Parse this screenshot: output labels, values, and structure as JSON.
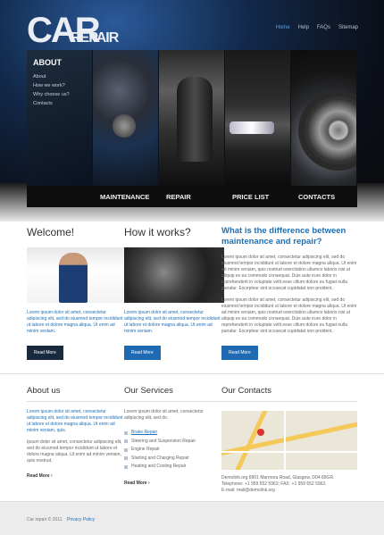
{
  "header": {
    "logo_big": "CAR",
    "logo_small": "REPAIR",
    "nav": [
      "Home",
      "Help",
      "FAQs",
      "Sitemap"
    ]
  },
  "about_panel": {
    "title": "ABOUT",
    "items": [
      "About",
      "How we work?",
      "Why choose us?",
      "Contacts"
    ]
  },
  "menu": [
    "Maintenance",
    "Repair",
    "Price list",
    "Contacts"
  ],
  "welcome": {
    "title": "Welcome!",
    "text": "Lorem ipsum dolor sit amet, consectetur adipiscing elit, sed do eiusmod tempor incididunt ut labore et dolore magna aliqua. Ut enim ad minim veniam.",
    "button": "Read More"
  },
  "how": {
    "title": "How it works?",
    "text": "Lorem ipsum dolor sit amet, consectetur adipiscing elit, sed do eiusmod tempor incididunt ut labore et dolore magna aliqua. Ut enim ad minim veniam.",
    "button": "Read More"
  },
  "difference": {
    "title": "What is the difference between maintenance and repair?",
    "p1": "Lorem ipsum dolor sit amet, consectetur adipiscing elit, sed do eiusmod tempor incididunt ut labore et dolore magna aliqua. Ut enim ad minim veniam, quis nostrud exercitation ullamco laboris nisi ut aliquip ex ea commodo consequat. Duis aute irure dolor in reprehenderit in voluptate velit esse cillum dolore eu fugiat nulla pariatur. Excepteur sint occaecat cupidatat non proident.",
    "p2": "Lorem ipsum dolor sit amet, consectetur adipiscing elit, sed do eiusmod tempor incididunt ut labore et dolore magna aliqua. Ut enim ad minim veniam, quis nostrud exercitation ullamco laboris nisi ut aliquip ex ea commodo consequat. Duis aute irure dolor in reprehenderit in voluptate velit esse cillum dolore eu fugiat nulla pariatur. Excepteur sint occaecat cupidatat non proident.",
    "button": "Read More"
  },
  "about_us": {
    "title": "About us",
    "text_blue": "Lorem ipsum dolor sit amet, consectetur adipiscing elit, sed do eiusmod tempor incididunt ut labore et dolore magna aliqua. Ut enim ad minim veniam, quis.",
    "text_grey": "Ipsum dolor sit amet, consectetur adipiscing elit, sed do eiusmod tempor incididunt ut labore et dolore magna aliqua. Ut enim ad minim veniam, quis nostrud.",
    "read_more": "Read More"
  },
  "services": {
    "title": "Our Services",
    "intro": "Lorem ipsum dolor sit amet, consectetur adipiscing elit, sed do.",
    "items": [
      "Brake Repair",
      "Steering and Suspension Repair",
      "Engine Repair",
      "Starting and Charging Repair",
      "Heating and Cooling Repair"
    ],
    "read_more": "Read More"
  },
  "contacts": {
    "title": "Our Contacts",
    "address": "Demolink.org 8901 Marmora Road, Glasgow, D04 89GR.",
    "phone": "Telephone: +1 959 552 5963;   FAX: +1 959 552 5963.",
    "email": "E-mail: mail@demolink.org"
  },
  "footer": {
    "copyright": "Car repair © 2011",
    "privacy": "Privacy Policy"
  }
}
